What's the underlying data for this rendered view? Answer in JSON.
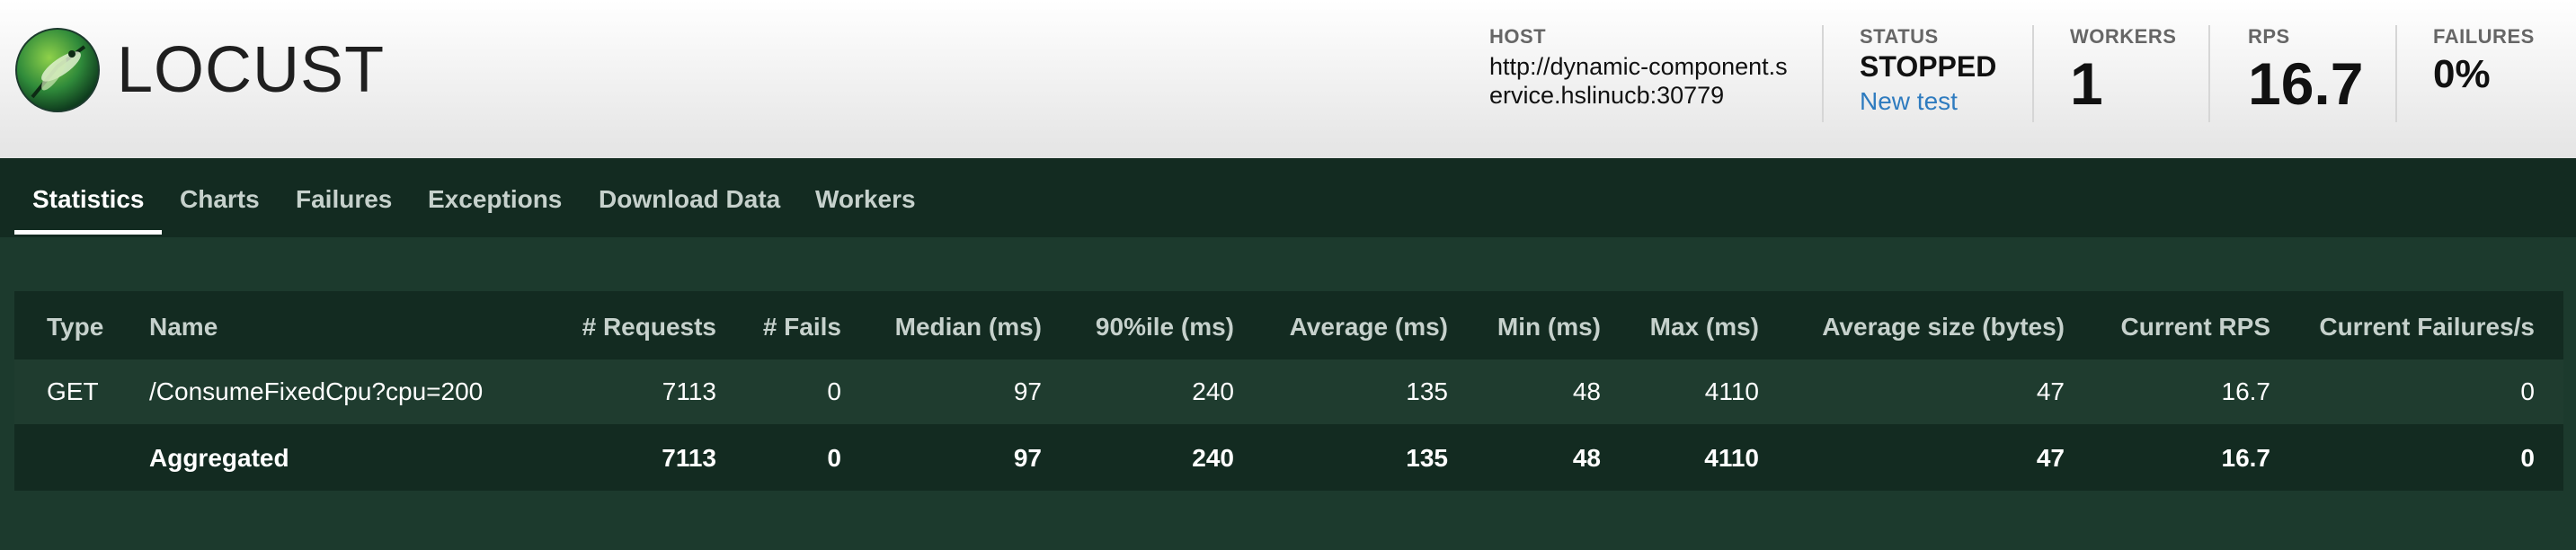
{
  "header": {
    "logo_text": "LOCUST",
    "host_label": "HOST",
    "host_value": "http://dynamic-component.service.hslinucb:30779",
    "status_label": "STATUS",
    "status_value": "STOPPED",
    "new_test_label": "New test",
    "workers_label": "WORKERS",
    "workers_value": "1",
    "rps_label": "RPS",
    "rps_value": "16.7",
    "failures_label": "FAILURES",
    "failures_value": "0%"
  },
  "tabs": [
    {
      "label": "Statistics",
      "active": true
    },
    {
      "label": "Charts"
    },
    {
      "label": "Failures"
    },
    {
      "label": "Exceptions"
    },
    {
      "label": "Download Data"
    },
    {
      "label": "Workers"
    }
  ],
  "table": {
    "columns": [
      "Type",
      "Name",
      "# Requests",
      "# Fails",
      "Median (ms)",
      "90%ile (ms)",
      "Average (ms)",
      "Min (ms)",
      "Max (ms)",
      "Average size (bytes)",
      "Current RPS",
      "Current Failures/s"
    ],
    "rows": [
      [
        "GET",
        "/ConsumeFixedCpu?cpu=200",
        "7113",
        "0",
        "97",
        "240",
        "135",
        "48",
        "4110",
        "47",
        "16.7",
        "0"
      ]
    ],
    "aggregated": [
      "",
      "Aggregated",
      "7113",
      "0",
      "97",
      "240",
      "135",
      "48",
      "4110",
      "47",
      "16.7",
      "0"
    ]
  },
  "colors": {
    "header_bg": "#ffffff",
    "nav_bg": "#132b21",
    "page_bg": "#1c3a2d",
    "row_bg": "#1f3c2f",
    "link": "#2e7bbf"
  }
}
